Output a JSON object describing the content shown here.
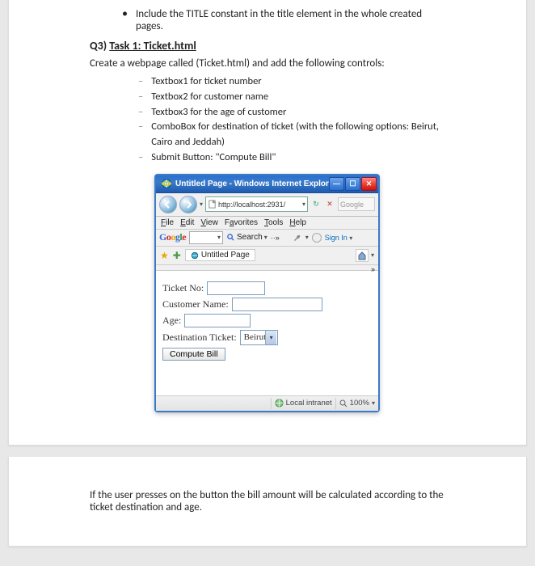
{
  "doc": {
    "bullet_title_instruction": "Include the TITLE constant in the title element in the whole created pages.",
    "q3_label": "Q3)",
    "task_heading": "Task 1: Ticket.html",
    "intro": "Create a webpage called (Ticket.html) and add the following controls:",
    "reqs": [
      "Textbox1 for ticket number",
      "Textbox2 for customer name",
      "Textbox3 for the age of customer",
      "ComboBox for destination of ticket (with the following options: Beirut, Cairo and Jeddah)",
      "Submit Button: \"Compute Bill\""
    ],
    "page2_text": "If the user presses on the button the bill amount will be calculated according to the ticket destination and age."
  },
  "ie": {
    "title": "Untitled Page - Windows Internet Explorer",
    "url": "http://localhost:2931/",
    "search_placeholder": "Google",
    "menu": {
      "file": "File",
      "edit": "Edit",
      "view": "View",
      "favorites": "Favorites",
      "tools": "Tools",
      "help": "Help"
    },
    "google_toolbar": {
      "search_label": "Search",
      "signin": "Sign In"
    },
    "tab_title": "Untitled Page",
    "form": {
      "ticket_label": "Ticket No:",
      "customer_label": "Customer Name:",
      "age_label": "Age:",
      "dest_label": "Destination Ticket:",
      "dest_value": "Beirut",
      "submit_label": "Compute Bill"
    },
    "status": {
      "zone": "Local intranet",
      "zoom": "100%"
    }
  }
}
